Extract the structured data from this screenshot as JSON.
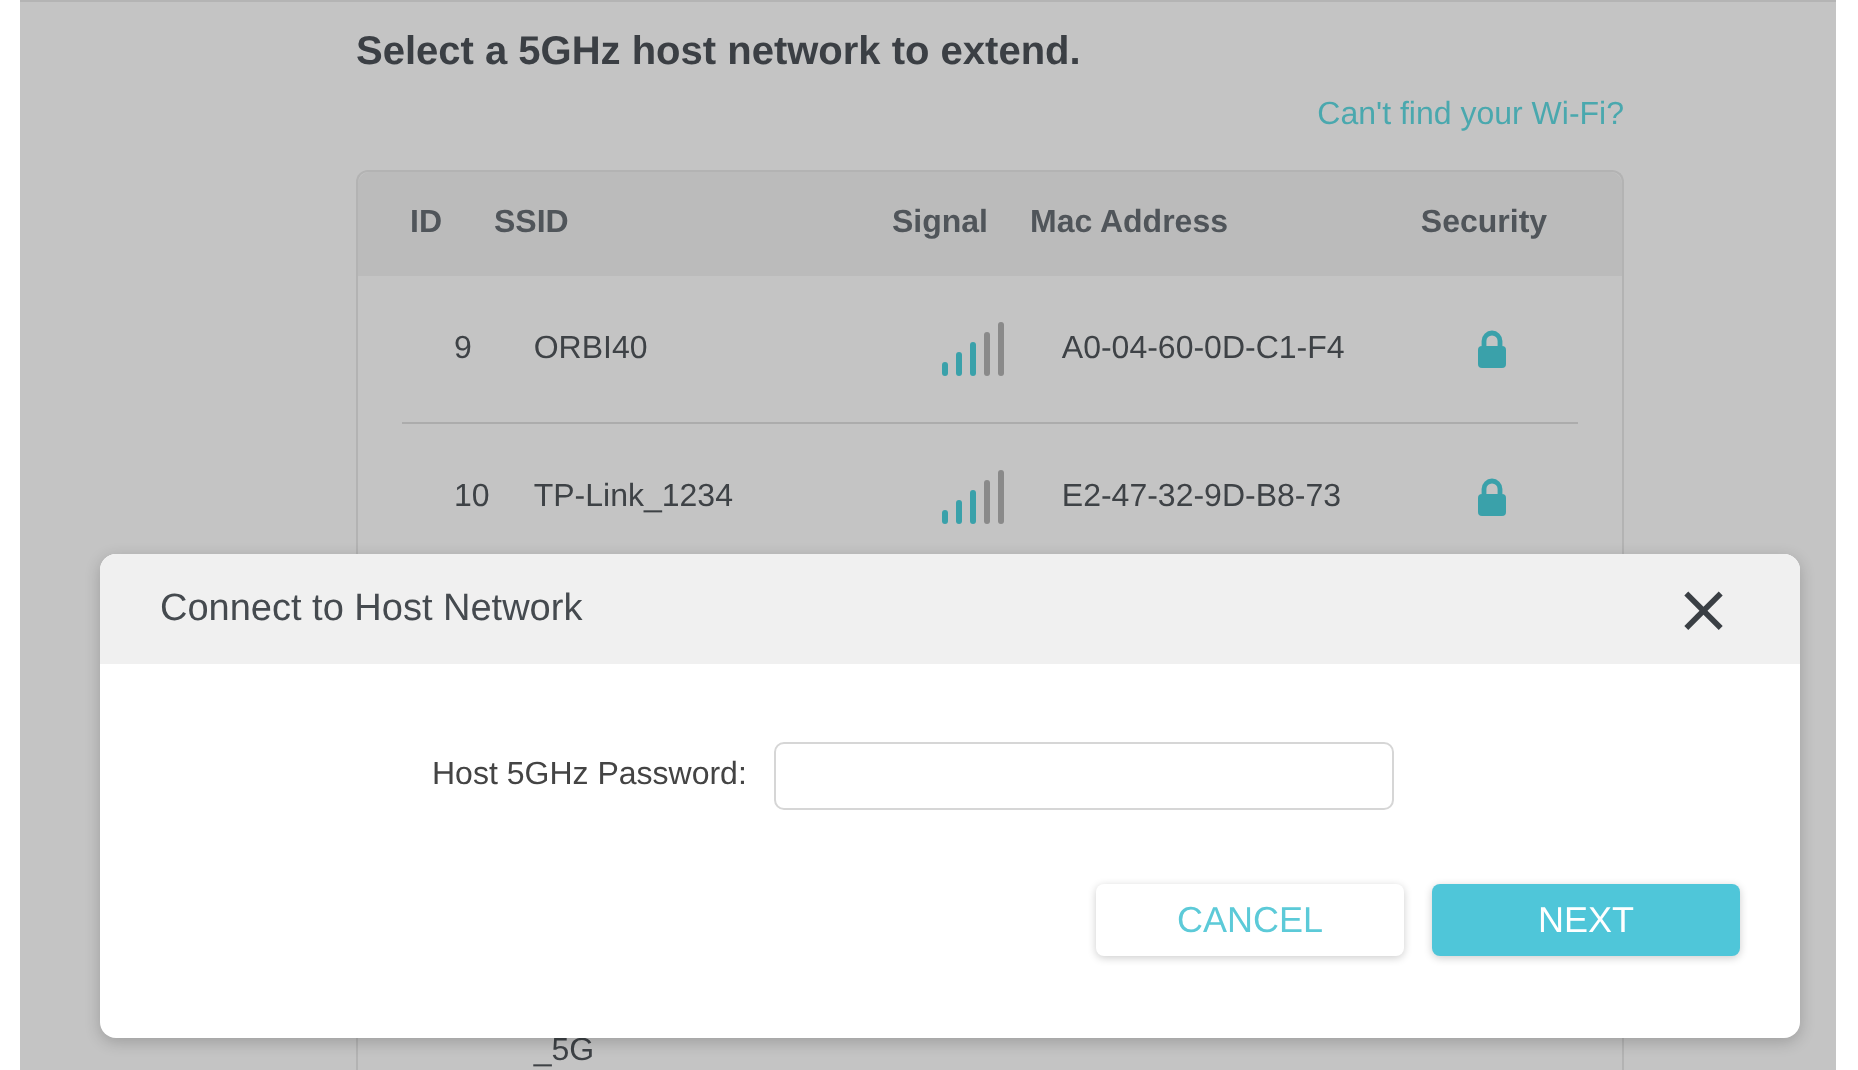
{
  "heading": "Select a 5GHz host network to extend.",
  "help_link": "Can't find your Wi-Fi?",
  "table": {
    "columns": [
      "ID",
      "SSID",
      "Signal",
      "Mac Address",
      "Security"
    ],
    "rows": [
      {
        "id": "9",
        "ssid": "ORBI40",
        "mac": "A0-04-60-0D-C1-F4"
      },
      {
        "id": "10",
        "ssid": "TP-Link_1234",
        "mac": "E2-47-32-9D-B8-73"
      },
      {
        "ssid": "_5G"
      }
    ]
  },
  "dialog": {
    "title": "Connect to Host Network",
    "close": "×",
    "field_label": "Host 5GHz Password:",
    "buttons": [
      {
        "label": "CANCEL",
        "kind": "secondary"
      },
      {
        "label": "NEXT",
        "kind": "primary"
      }
    ]
  }
}
